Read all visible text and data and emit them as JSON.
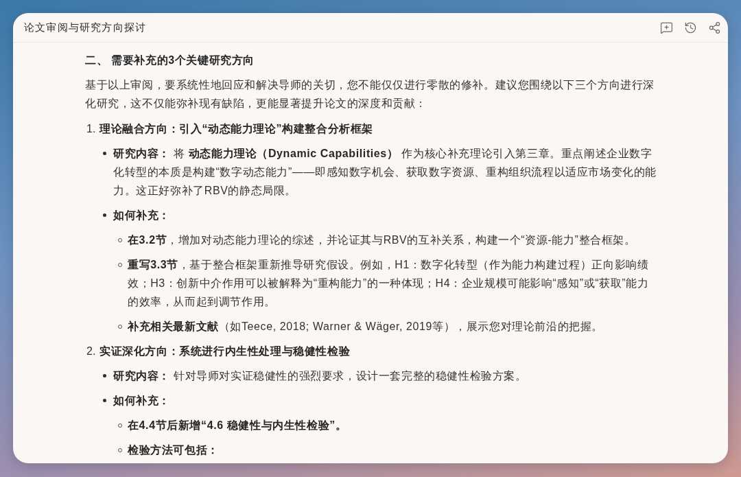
{
  "window": {
    "title": "论文审阅与研究方向探讨"
  },
  "section": {
    "heading": "二、 需要补充的3个关键研究方向",
    "intro": "基于以上审阅，要系统性地回应和解决导师的关切，您不能仅仅进行零散的修补。建议您围绕以下三个方向进行深化研究，这不仅能弥补现有缺陷，更能显著提升论文的深度和贡献：",
    "directions": [
      {
        "number": "1.",
        "title": "理论融合方向：引入“动态能力理论”构建整合分析框架",
        "items": [
          {
            "text": "**研究内容：** 将 **动态能力理论（Dynamic Capabilities）** 作为核心补充理论引入第三章。重点阐述企业数字化转型的本质是构建“数字动态能力”——即感知数字机会、获取数字资源、重构组织流程以适应市场变化的能力。这正好弥补了RBV的静态局限。"
          },
          {
            "text": "**如何补充：**",
            "children": [
              {
                "text": "**在3.2节**，增加对动态能力理论的综述，并论证其与RBV的互补关系，构建一个“资源-能力”整合框架。"
              },
              {
                "text": "**重写3.3节**，基于整合框架重新推导研究假设。例如，H1：数字化转型（作为能力构建过程）正向影响绩效；H3：创新中介作用可以被解释为“重构能力”的一种体现；H4：企业规模可能影响“感知”或“获取”能力的效率，从而起到调节作用。"
              },
              {
                "text": "**补充相关最新文献**（如Teece, 2018; Warner & Wäger, 2019等），展示您对理论前沿的把握。"
              }
            ]
          }
        ]
      },
      {
        "number": "2.",
        "title": "实证深化方向：系统进行内生性处理与稳健性检验",
        "items": [
          {
            "text": "**研究内容：** 针对导师对实证稳健性的强烈要求，设计一套完整的稳健性检验方案。"
          },
          {
            "text": "**如何补充：**",
            "children": [
              {
                "text": "**在4.4节后新增“4.6 稳健性与内生性检验”。**"
              },
              {
                "text": "**检验方法可包括：**"
              }
            ]
          }
        ]
      }
    ]
  }
}
